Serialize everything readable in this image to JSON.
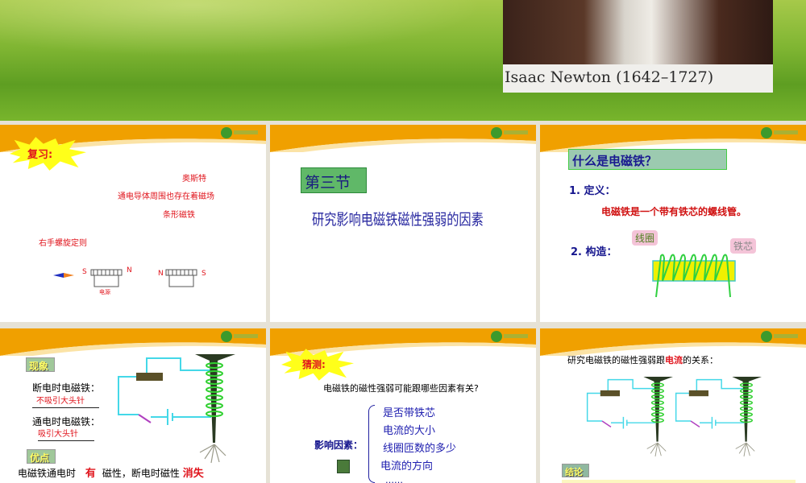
{
  "banner": {
    "portrait_caption": "Isaac Newton (1642–1727)"
  },
  "slides": [
    {
      "burst": "复习:",
      "lines": [
        "奥斯特",
        "通电导体周围也存在着磁场",
        "条形磁铁",
        "右手螺旋定则"
      ],
      "coil1": {
        "left": "S",
        "right": "N",
        "label": "电源"
      },
      "coil2": {
        "left": "N",
        "right": "S"
      }
    },
    {
      "section": "第三节",
      "title": "研究影响电磁铁磁性强弱的因素"
    },
    {
      "heading": "什么是电磁铁？",
      "def_label": "1. 定义：",
      "definition": "电磁铁是一个带有铁芯的螺线管。",
      "struct_label": "2. 构造：",
      "coil_label": "线圈",
      "core_label": "铁芯"
    },
    {
      "phenomenon": "现象",
      "off_label": "断电时电磁铁：",
      "off_answer": "不吸引大头针",
      "on_label": "通电时电磁铁：",
      "on_answer": "吸引大头针",
      "advantage": "优点",
      "summary": [
        "电磁铁通电时",
        "有",
        "磁性，断电时磁性",
        "消失"
      ]
    },
    {
      "burst": "猜测:",
      "question": "电磁铁的磁性强弱可能跟哪些因素有关?",
      "factors_label": "影响因素：",
      "factors": [
        "是否带铁芯",
        "电流的大小",
        "线圈匝数的多少",
        "电流的方向",
        "……"
      ]
    },
    {
      "title_pre": "研究电磁铁的磁性强弱跟",
      "title_hl": "电流",
      "title_post": "的关系：",
      "conclusion": "结论"
    }
  ]
}
